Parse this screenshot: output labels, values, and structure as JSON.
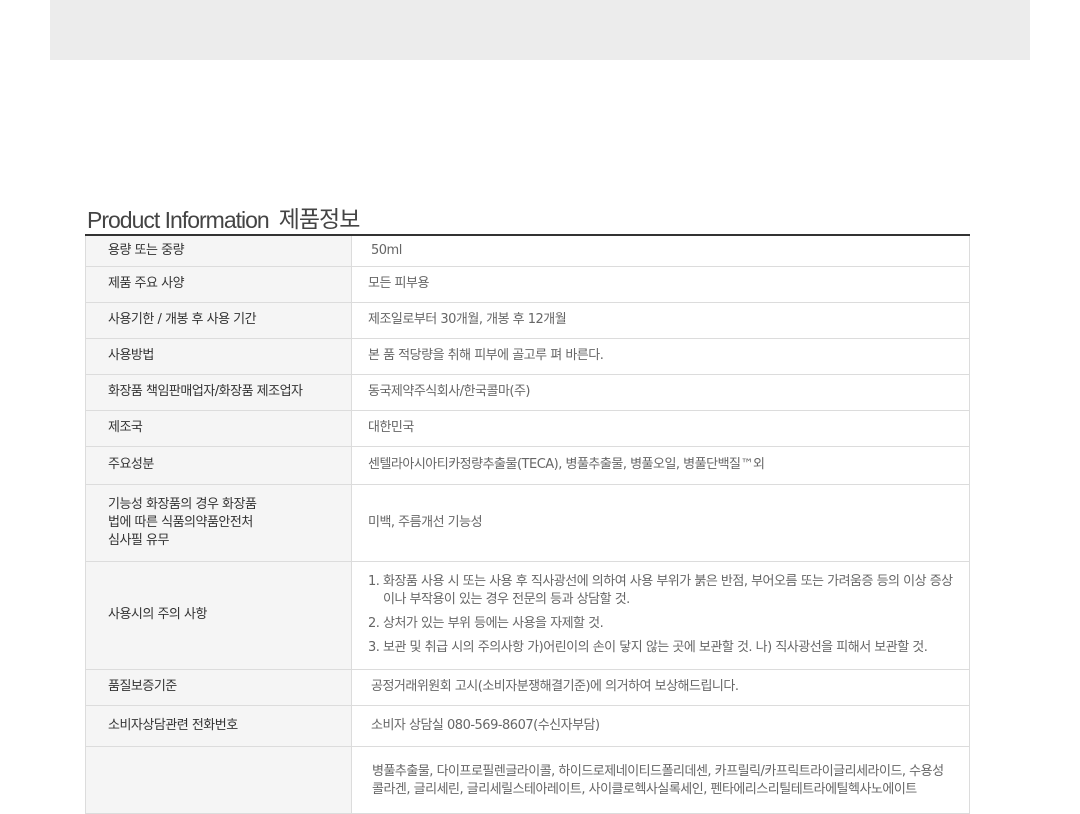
{
  "section": {
    "title_en": "Product Information",
    "title_ko": "제품정보"
  },
  "rows": [
    {
      "label": "용량 또는 중량",
      "value": "50ml"
    },
    {
      "label": "제품 주요 사양",
      "value": "모든 피부용"
    },
    {
      "label": "사용기한 / 개봉 후 사용 기간",
      "value": "제조일로부터 30개월, 개봉 후 12개월"
    },
    {
      "label": "사용방법",
      "value": "본 품 적당량을 취해 피부에 골고루 펴 바른다."
    },
    {
      "label": "화장품 책임판매업자/화장품 제조업자",
      "value": "동국제약주식회사/한국콜마(주)"
    },
    {
      "label": "제조국",
      "value": "대한민국"
    },
    {
      "label": "주요성분",
      "value": "센텔라아시아티카정량추출물(TECA), 병풀추출물, 병풀오일, 병풀단백질™외"
    },
    {
      "label_lines": [
        "기능성 화장품의 경우 화장품",
        "법에 따른 식품의약품안전처",
        "심사필 유무"
      ],
      "value": "미백, 주름개선 기능성"
    },
    {
      "label": "사용시의 주의 사항",
      "items": [
        "화장품 사용 시 또는 사용 후 직사광선에 의하여 사용 부위가 붉은 반점, 부어오름 또는 가려움증 등의 이상 증상이나 부작용이 있는 경우 전문의 등과 상담할 것.",
        "상처가 있는 부위 등에는 사용을 자제할 것.",
        "보관 및 취급 시의 주의사항 가)어린이의 손이 닿지 않는 곳에 보관할 것. 나) 직사광선을 피해서 보관할 것."
      ]
    },
    {
      "label": "품질보증기준",
      "value": "공정거래위원회 고시(소비자분쟁해결기준)에 의거하여 보상해드립니다."
    },
    {
      "label": "소비자상담관련 전화번호",
      "value": "소비자 상담실 080-569-8607(수신자부담)"
    },
    {
      "label": "",
      "value": "병풀추출물, 다이프로필렌글라이콜, 하이드로제네이티드폴리데센, 카프릴릭/카프릭트라이글리세라이드, 수용성콜라겐, 글리세린, 글리세릴스테아레이트, 사이클로헥사실록세인, 펜타에리스리틸테트라에틸헥사노에이트"
    }
  ]
}
